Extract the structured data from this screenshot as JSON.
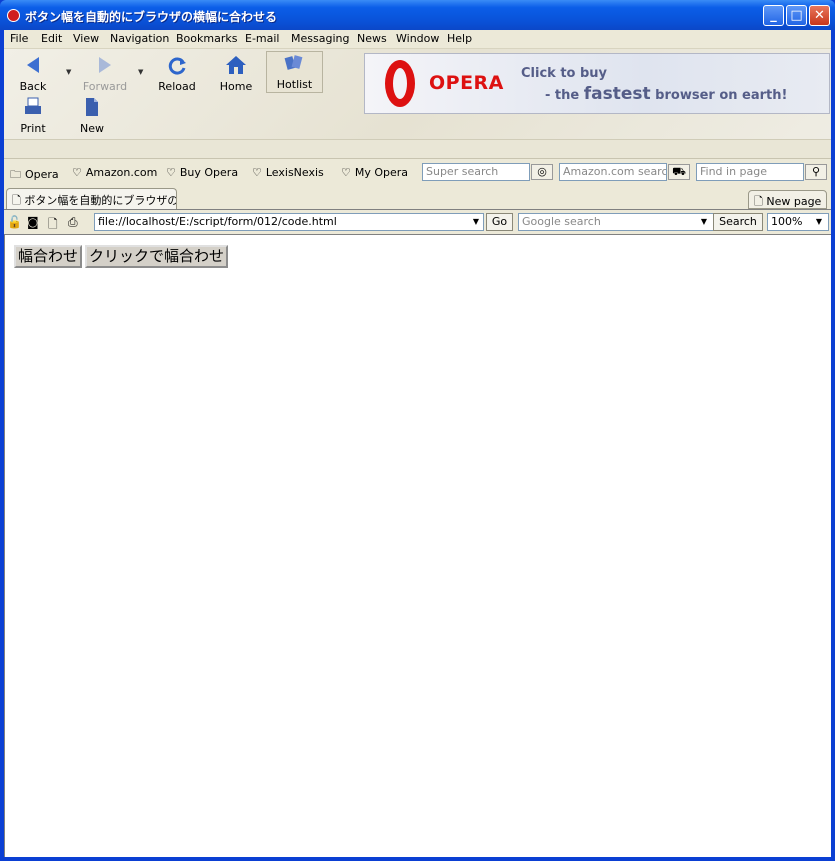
{
  "window": {
    "title": "ボタン幅を自動的にブラウザの横幅に合わせる"
  },
  "menu": [
    "File",
    "Edit",
    "View",
    "Navigation",
    "Bookmarks",
    "E-mail",
    "Messaging",
    "News",
    "Window",
    "Help"
  ],
  "toolbar": {
    "back": "Back",
    "forward": "Forward",
    "reload": "Reload",
    "home": "Home",
    "hotlist": "Hotlist",
    "print": "Print",
    "new": "New"
  },
  "banner": {
    "brand": "OPERA",
    "line1": "Click to buy",
    "line2_pre": "- the",
    "line2_big": "fastest",
    "line2_post": "browser on earth!"
  },
  "personal_bar": {
    "items": [
      "Opera",
      "Amazon.com",
      "Buy Opera",
      "LexisNexis",
      "My Opera"
    ],
    "super_search_placeholder": "Super search",
    "amazon_search_placeholder": "Amazon.com search",
    "find_placeholder": "Find in page"
  },
  "tabs": {
    "active": "ボタン幅を自動的にブラウザの...",
    "new_page": "New page"
  },
  "address": {
    "url": "file://localhost/E:/script/form/012/code.html",
    "go": "Go",
    "google_placeholder": "Google search",
    "search": "Search",
    "zoom": "100%"
  },
  "content": {
    "button1": "幅合わせ",
    "button2": "クリックで幅合わせ"
  },
  "colors": {
    "titlebar": "#0b5ee8",
    "chrome": "#ece9d8",
    "opera_red": "#dd1111"
  }
}
